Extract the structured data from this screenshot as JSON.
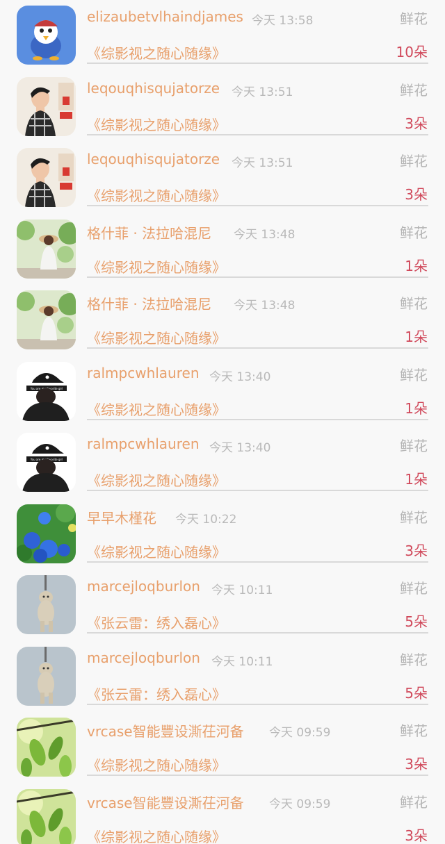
{
  "gift_list": [
    {
      "username": "elizaubetvlhaindjames",
      "time": "今天 13:58",
      "gift_type": "鲜花",
      "work": "《综影视之随心随缘》",
      "count": "10朵",
      "avatar": "cartoon-bird-avatar"
    },
    {
      "username": "leqouqhisqujatorze",
      "time": "今天 13:51",
      "gift_type": "鲜花",
      "work": "《综影视之随心随缘》",
      "count": "3朵",
      "avatar": "boy-photo-avatar"
    },
    {
      "username": "leqouqhisqujatorze",
      "time": "今天 13:51",
      "gift_type": "鲜花",
      "work": "《综影视之随心随缘》",
      "count": "3朵",
      "avatar": "boy-photo-avatar"
    },
    {
      "username": "格什菲 · 法拉哈混尼",
      "time": "今天 13:48",
      "gift_type": "鲜花",
      "work": "《综影视之随心随缘》",
      "count": "1朵",
      "avatar": "girl-garden-avatar"
    },
    {
      "username": "格什菲 · 法拉哈混尼",
      "time": "今天 13:48",
      "gift_type": "鲜花",
      "work": "《综影视之随心随缘》",
      "count": "1朵",
      "avatar": "girl-garden-avatar"
    },
    {
      "username": "ralmpcwhlauren",
      "time": "今天 13:40",
      "gift_type": "鲜花",
      "work": "《综影视之随心随缘》",
      "count": "1朵",
      "avatar": "cap-girl-avatar"
    },
    {
      "username": "ralmpcwhlauren",
      "time": "今天 13:40",
      "gift_type": "鲜花",
      "work": "《综影视之随心随缘》",
      "count": "1朵",
      "avatar": "cap-girl-avatar"
    },
    {
      "username": "早早木槿花",
      "time": "今天 10:22",
      "gift_type": "鲜花",
      "work": "《综影视之随心随缘》",
      "count": "3朵",
      "avatar": "blue-flowers-avatar"
    },
    {
      "username": "marcejloqburlon",
      "time": "今天 10:11",
      "gift_type": "鲜花",
      "work": "《张云雷：绣入磊心》",
      "count": "5朵",
      "avatar": "puppy-avatar"
    },
    {
      "username": "marcejloqburlon",
      "time": "今天 10:11",
      "gift_type": "鲜花",
      "work": "《张云雷：绣入磊心》",
      "count": "5朵",
      "avatar": "puppy-avatar"
    },
    {
      "username": "vrcase智能豐设澌茌河备",
      "time": "今天 09:59",
      "gift_type": "鲜花",
      "work": "《综影视之随心随缘》",
      "count": "3朵",
      "avatar": "green-leaves-avatar"
    },
    {
      "username": "vrcase智能豐设澌茌河备",
      "time": "今天 09:59",
      "gift_type": "鲜花",
      "work": "《综影视之随心随缘》",
      "count": "3朵",
      "avatar": "green-leaves-avatar"
    }
  ]
}
